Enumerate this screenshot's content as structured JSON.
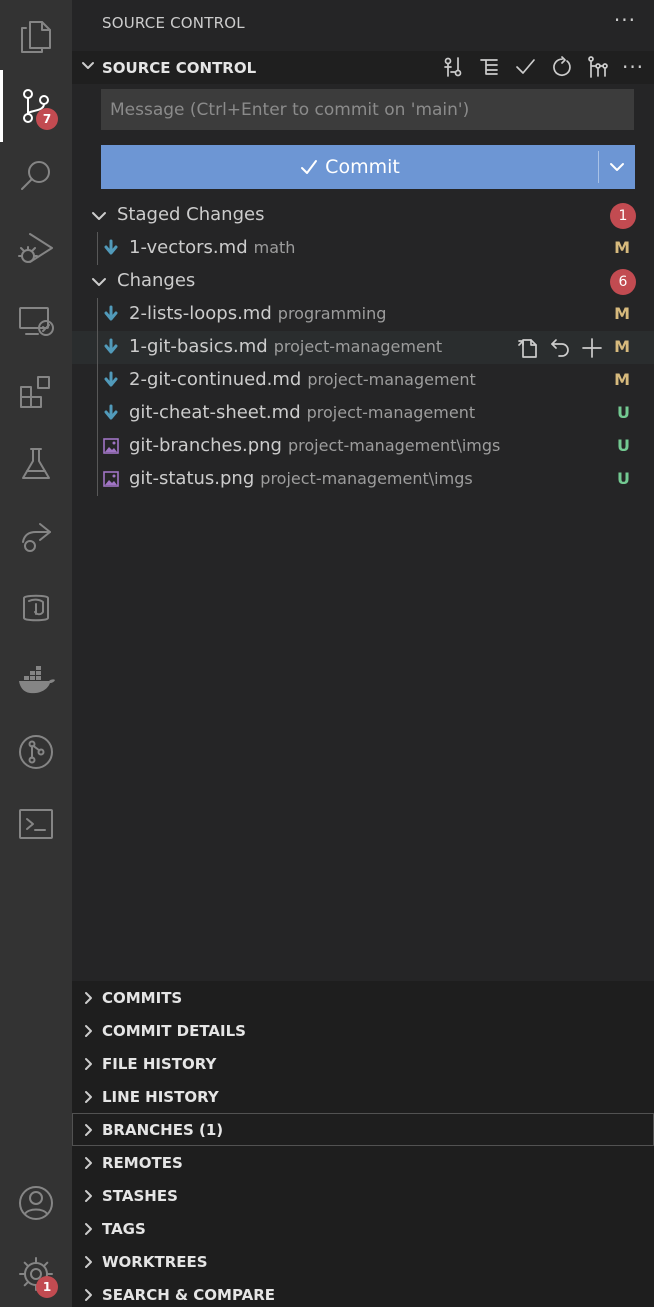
{
  "activity_bar": {
    "items": [
      {
        "name": "explorer-icon"
      },
      {
        "name": "source-control-icon",
        "badge": "7"
      },
      {
        "name": "search-icon"
      },
      {
        "name": "run-debug-icon"
      },
      {
        "name": "remote-explorer-icon"
      },
      {
        "name": "extensions-icon"
      },
      {
        "name": "testing-icon"
      },
      {
        "name": "live-share-icon"
      },
      {
        "name": "database-icon"
      },
      {
        "name": "docker-icon"
      },
      {
        "name": "git-graph-icon"
      },
      {
        "name": "terminal-icon"
      }
    ],
    "accounts_icon": "accounts-icon",
    "settings": {
      "icon": "gear-icon",
      "badge": "1"
    }
  },
  "sidebar": {
    "title": "SOURCE CONTROL",
    "section_title": "SOURCE CONTROL",
    "toolbar_icons": [
      "compare-icon",
      "tree-view-icon",
      "commit-check-icon",
      "refresh-icon",
      "branch-graph-icon",
      "more-icon"
    ]
  },
  "commit": {
    "placeholder": "Message (Ctrl+Enter to commit on 'main')",
    "value": "",
    "button_label": "Commit"
  },
  "staged": {
    "label": "Staged Changes",
    "count": "1",
    "files": [
      {
        "name": "1-vectors.md",
        "path": "math",
        "status": "M",
        "type": "md"
      }
    ]
  },
  "changes": {
    "label": "Changes",
    "count": "6",
    "files": [
      {
        "name": "2-lists-loops.md",
        "path": "programming",
        "status": "M",
        "type": "md"
      },
      {
        "name": "1-git-basics.md",
        "path": "project-management",
        "status": "M",
        "type": "md",
        "hover": true
      },
      {
        "name": "2-git-continued.md",
        "path": "project-management",
        "status": "M",
        "type": "md"
      },
      {
        "name": "git-cheat-sheet.md",
        "path": "project-management",
        "status": "U",
        "type": "md"
      },
      {
        "name": "git-branches.png",
        "path": "project-management\\imgs",
        "status": "U",
        "type": "img"
      },
      {
        "name": "git-status.png",
        "path": "project-management\\imgs",
        "status": "U",
        "type": "img"
      }
    ]
  },
  "panels": [
    {
      "label": "COMMITS"
    },
    {
      "label": "COMMIT DETAILS"
    },
    {
      "label": "FILE HISTORY"
    },
    {
      "label": "LINE HISTORY"
    },
    {
      "label": "BRANCHES (1)",
      "focused": true
    },
    {
      "label": "REMOTES"
    },
    {
      "label": "STASHES"
    },
    {
      "label": "TAGS"
    },
    {
      "label": "WORKTREES"
    },
    {
      "label": "SEARCH & COMPARE"
    }
  ],
  "colors": {
    "activity_bar": "#333333",
    "sidebar": "#252526",
    "commit_button": "#6d96d4",
    "badge": "#c24b51",
    "modified": "#d7ba7d",
    "untracked": "#73c991"
  }
}
